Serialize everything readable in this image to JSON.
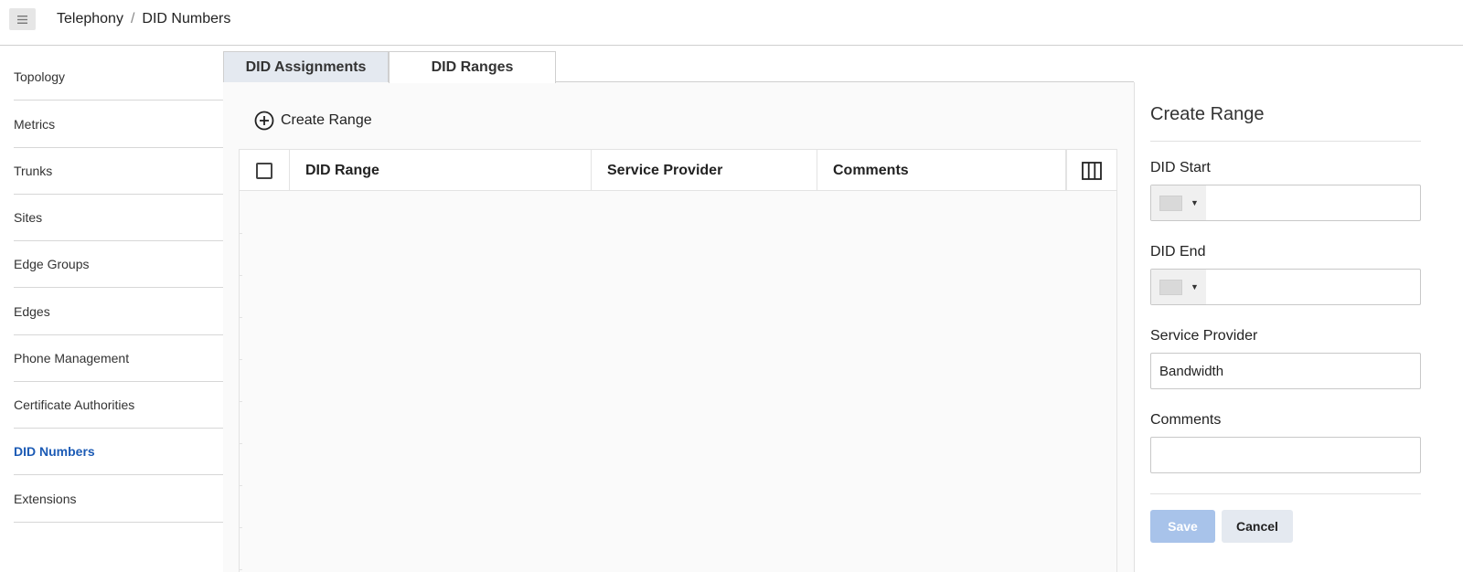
{
  "breadcrumb": {
    "parent": "Telephony",
    "separator": "/",
    "current": "DID Numbers"
  },
  "sidebar": {
    "items": [
      {
        "label": "Topology"
      },
      {
        "label": "Metrics"
      },
      {
        "label": "Trunks"
      },
      {
        "label": "Sites"
      },
      {
        "label": "Edge Groups"
      },
      {
        "label": "Edges"
      },
      {
        "label": "Phone Management"
      },
      {
        "label": "Certificate Authorities"
      },
      {
        "label": "DID Numbers",
        "active": true
      },
      {
        "label": "Extensions"
      }
    ]
  },
  "tabs": [
    {
      "label": "DID Assignments",
      "active": false
    },
    {
      "label": "DID Ranges",
      "active": true
    }
  ],
  "toolbar": {
    "create_label": "Create Range",
    "create_icon": "plus-circle-icon"
  },
  "table": {
    "columns": [
      "DID Range",
      "Service Provider",
      "Comments"
    ],
    "rows": [],
    "column_picker_icon": "columns-icon"
  },
  "panel": {
    "title": "Create Range",
    "did_start": {
      "label": "DID Start",
      "value": ""
    },
    "did_end": {
      "label": "DID End",
      "value": ""
    },
    "service_provider": {
      "label": "Service Provider",
      "value": "Bandwidth"
    },
    "comments": {
      "label": "Comments",
      "value": ""
    },
    "save_label": "Save",
    "cancel_label": "Cancel"
  },
  "colors": {
    "active_link": "#1c5bb5",
    "save_disabled": "#a8c3ea",
    "tab_inactive": "#e4e9f0"
  }
}
